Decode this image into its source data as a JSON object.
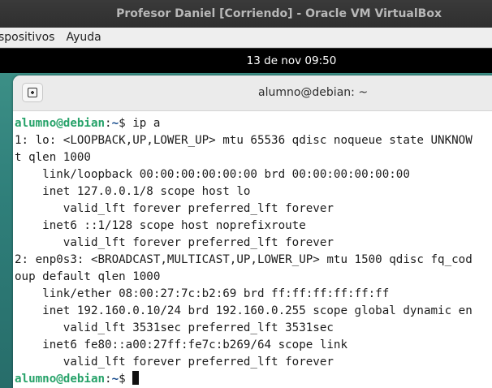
{
  "host_window": {
    "title": "Profesor Daniel [Corriendo] - Oracle VM VirtualBox",
    "menu": [
      "spositivos",
      "Ayuda"
    ]
  },
  "gnome_topbar": {
    "clock": "13 de nov  09:50"
  },
  "terminal": {
    "title": "alumno@debian: ~",
    "prompt": {
      "user_host": "alumno@debian",
      "separator": ":",
      "path": "~",
      "symbol": "$"
    },
    "command": " ip a",
    "output": [
      "1: lo: <LOOPBACK,UP,LOWER_UP> mtu 65536 qdisc noqueue state UNKNOW",
      "t qlen 1000",
      "    link/loopback 00:00:00:00:00:00 brd 00:00:00:00:00:00",
      "    inet 127.0.0.1/8 scope host lo",
      "       valid_lft forever preferred_lft forever",
      "    inet6 ::1/128 scope host noprefixroute",
      "       valid_lft forever preferred_lft forever",
      "2: enp0s3: <BROADCAST,MULTICAST,UP,LOWER_UP> mtu 1500 qdisc fq_cod",
      "oup default qlen 1000",
      "    link/ether 08:00:27:7c:b2:69 brd ff:ff:ff:ff:ff:ff",
      "    inet 192.160.0.10/24 brd 192.160.0.255 scope global dynamic en",
      "       valid_lft 3531sec preferred_lft 3531sec",
      "    inet6 fe80::a00:27ff:fe7c:b269/64 scope link",
      "       valid_lft forever preferred_lft forever"
    ]
  }
}
